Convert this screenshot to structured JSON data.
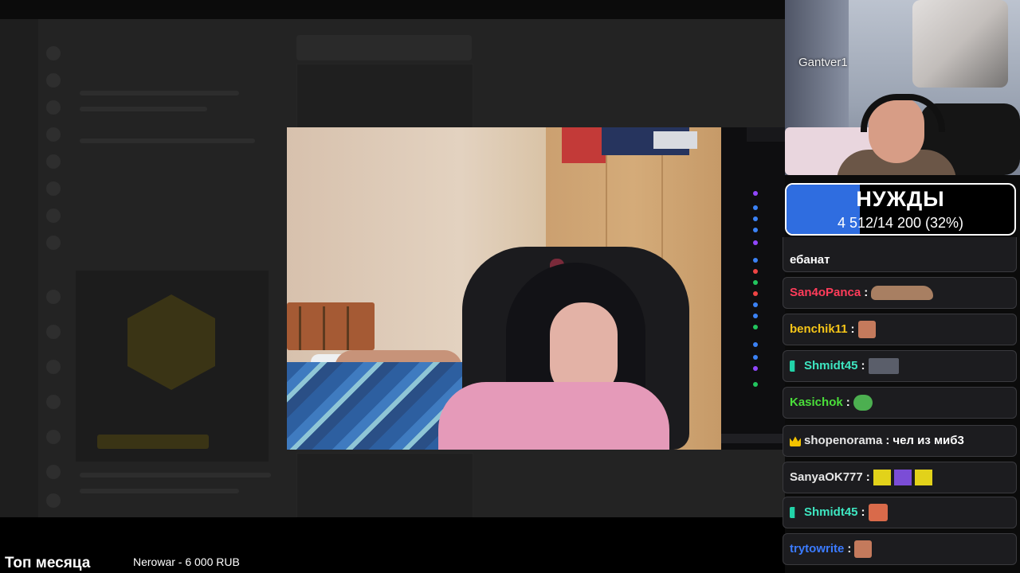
{
  "streamer": {
    "name": "Gantver1"
  },
  "goal": {
    "title": "НУЖДЫ",
    "progress_text": "4 512/14 200 (32%)",
    "current": 4512,
    "target": 14200,
    "percent": 32,
    "fill_color": "#2f6de0"
  },
  "bottom": {
    "top_month_label": "Топ месяца",
    "donor_entry": "Nerowar - 6 000 RUB"
  },
  "chat": {
    "partial_message_tail": "ебанат",
    "messages": [
      {
        "user": "San4oPanca",
        "color": "#ff3c5a",
        "badge": "",
        "text": "",
        "emote": "emote-capybara"
      },
      {
        "user": "benchik11",
        "color": "#f5c518",
        "badge": "",
        "text": "",
        "emote": "emote-face"
      },
      {
        "user": "Shmidt45",
        "color": "#3ee6c1",
        "badge": "vip-badge-icon",
        "text": "",
        "emote": "emote-picture"
      },
      {
        "user": "Kasichok",
        "color": "#4ade3a",
        "badge": "",
        "text": "",
        "emote": "emote-pepe"
      },
      {
        "user": "shopenorama",
        "color": "#e6e6e6",
        "badge": "crown-badge-icon",
        "text": "чел из миб3",
        "emote": ""
      },
      {
        "user": "SanyaOK777",
        "color": "#e6e6e6",
        "badge": "",
        "text": "",
        "emote": "emote-dance-row"
      },
      {
        "user": "Shmidt45",
        "color": "#3ee6c1",
        "badge": "vip-badge-icon",
        "text": "",
        "emote": "emote-face-red"
      },
      {
        "user": "trytowrite",
        "color": "#3b7bff",
        "badge": "",
        "text": "",
        "emote": "emote-face"
      }
    ]
  }
}
